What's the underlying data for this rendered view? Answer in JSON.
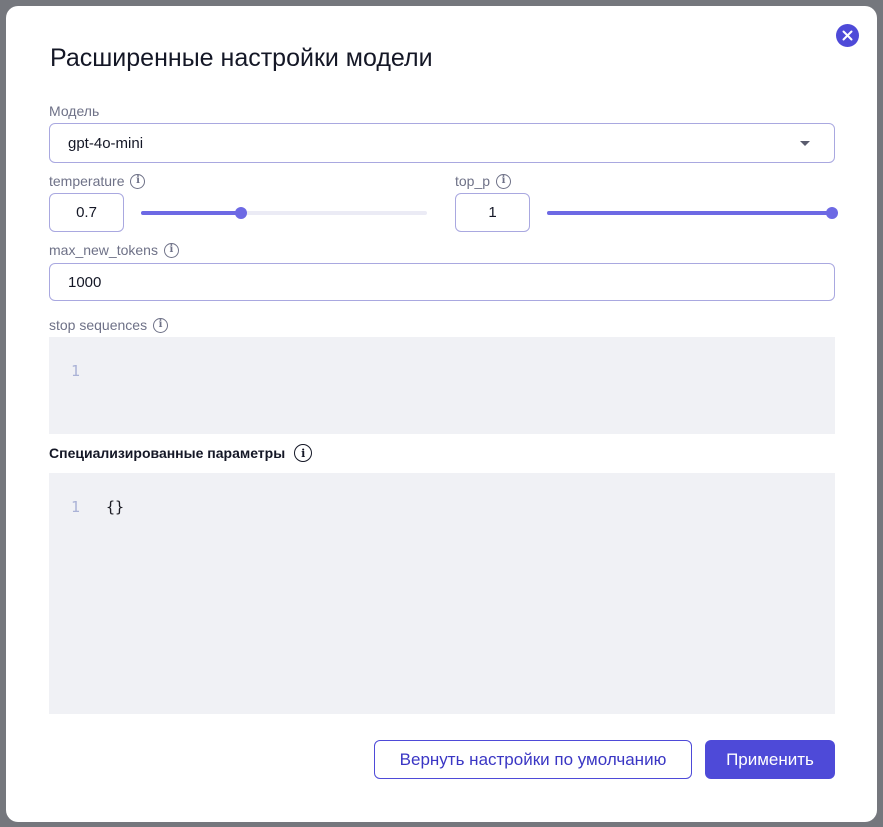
{
  "dialog": {
    "title": "Расширенные настройки модели",
    "close_icon": "close-icon"
  },
  "model": {
    "label": "Модель",
    "value": "gpt-4o-mini"
  },
  "temperature": {
    "label": "temperature",
    "value": "0.7",
    "slider_fraction": 0.35
  },
  "top_p": {
    "label": "top_p",
    "value": "1",
    "slider_fraction": 1.0
  },
  "max_new_tokens": {
    "label": "max_new_tokens",
    "value": "1000"
  },
  "stop_sequences": {
    "label": "stop sequences",
    "line_number": "1",
    "content": ""
  },
  "special_params": {
    "label": "Специализированные параметры",
    "line_number": "1",
    "content": "{}"
  },
  "buttons": {
    "reset_label": "Вернуть настройки по умолчанию",
    "apply_label": "Применить"
  },
  "colors": {
    "accent": "#4e4ad8",
    "slider": "#6d69e4",
    "input_border": "#a9a8e0",
    "editor_bg": "#f0f1f5"
  }
}
